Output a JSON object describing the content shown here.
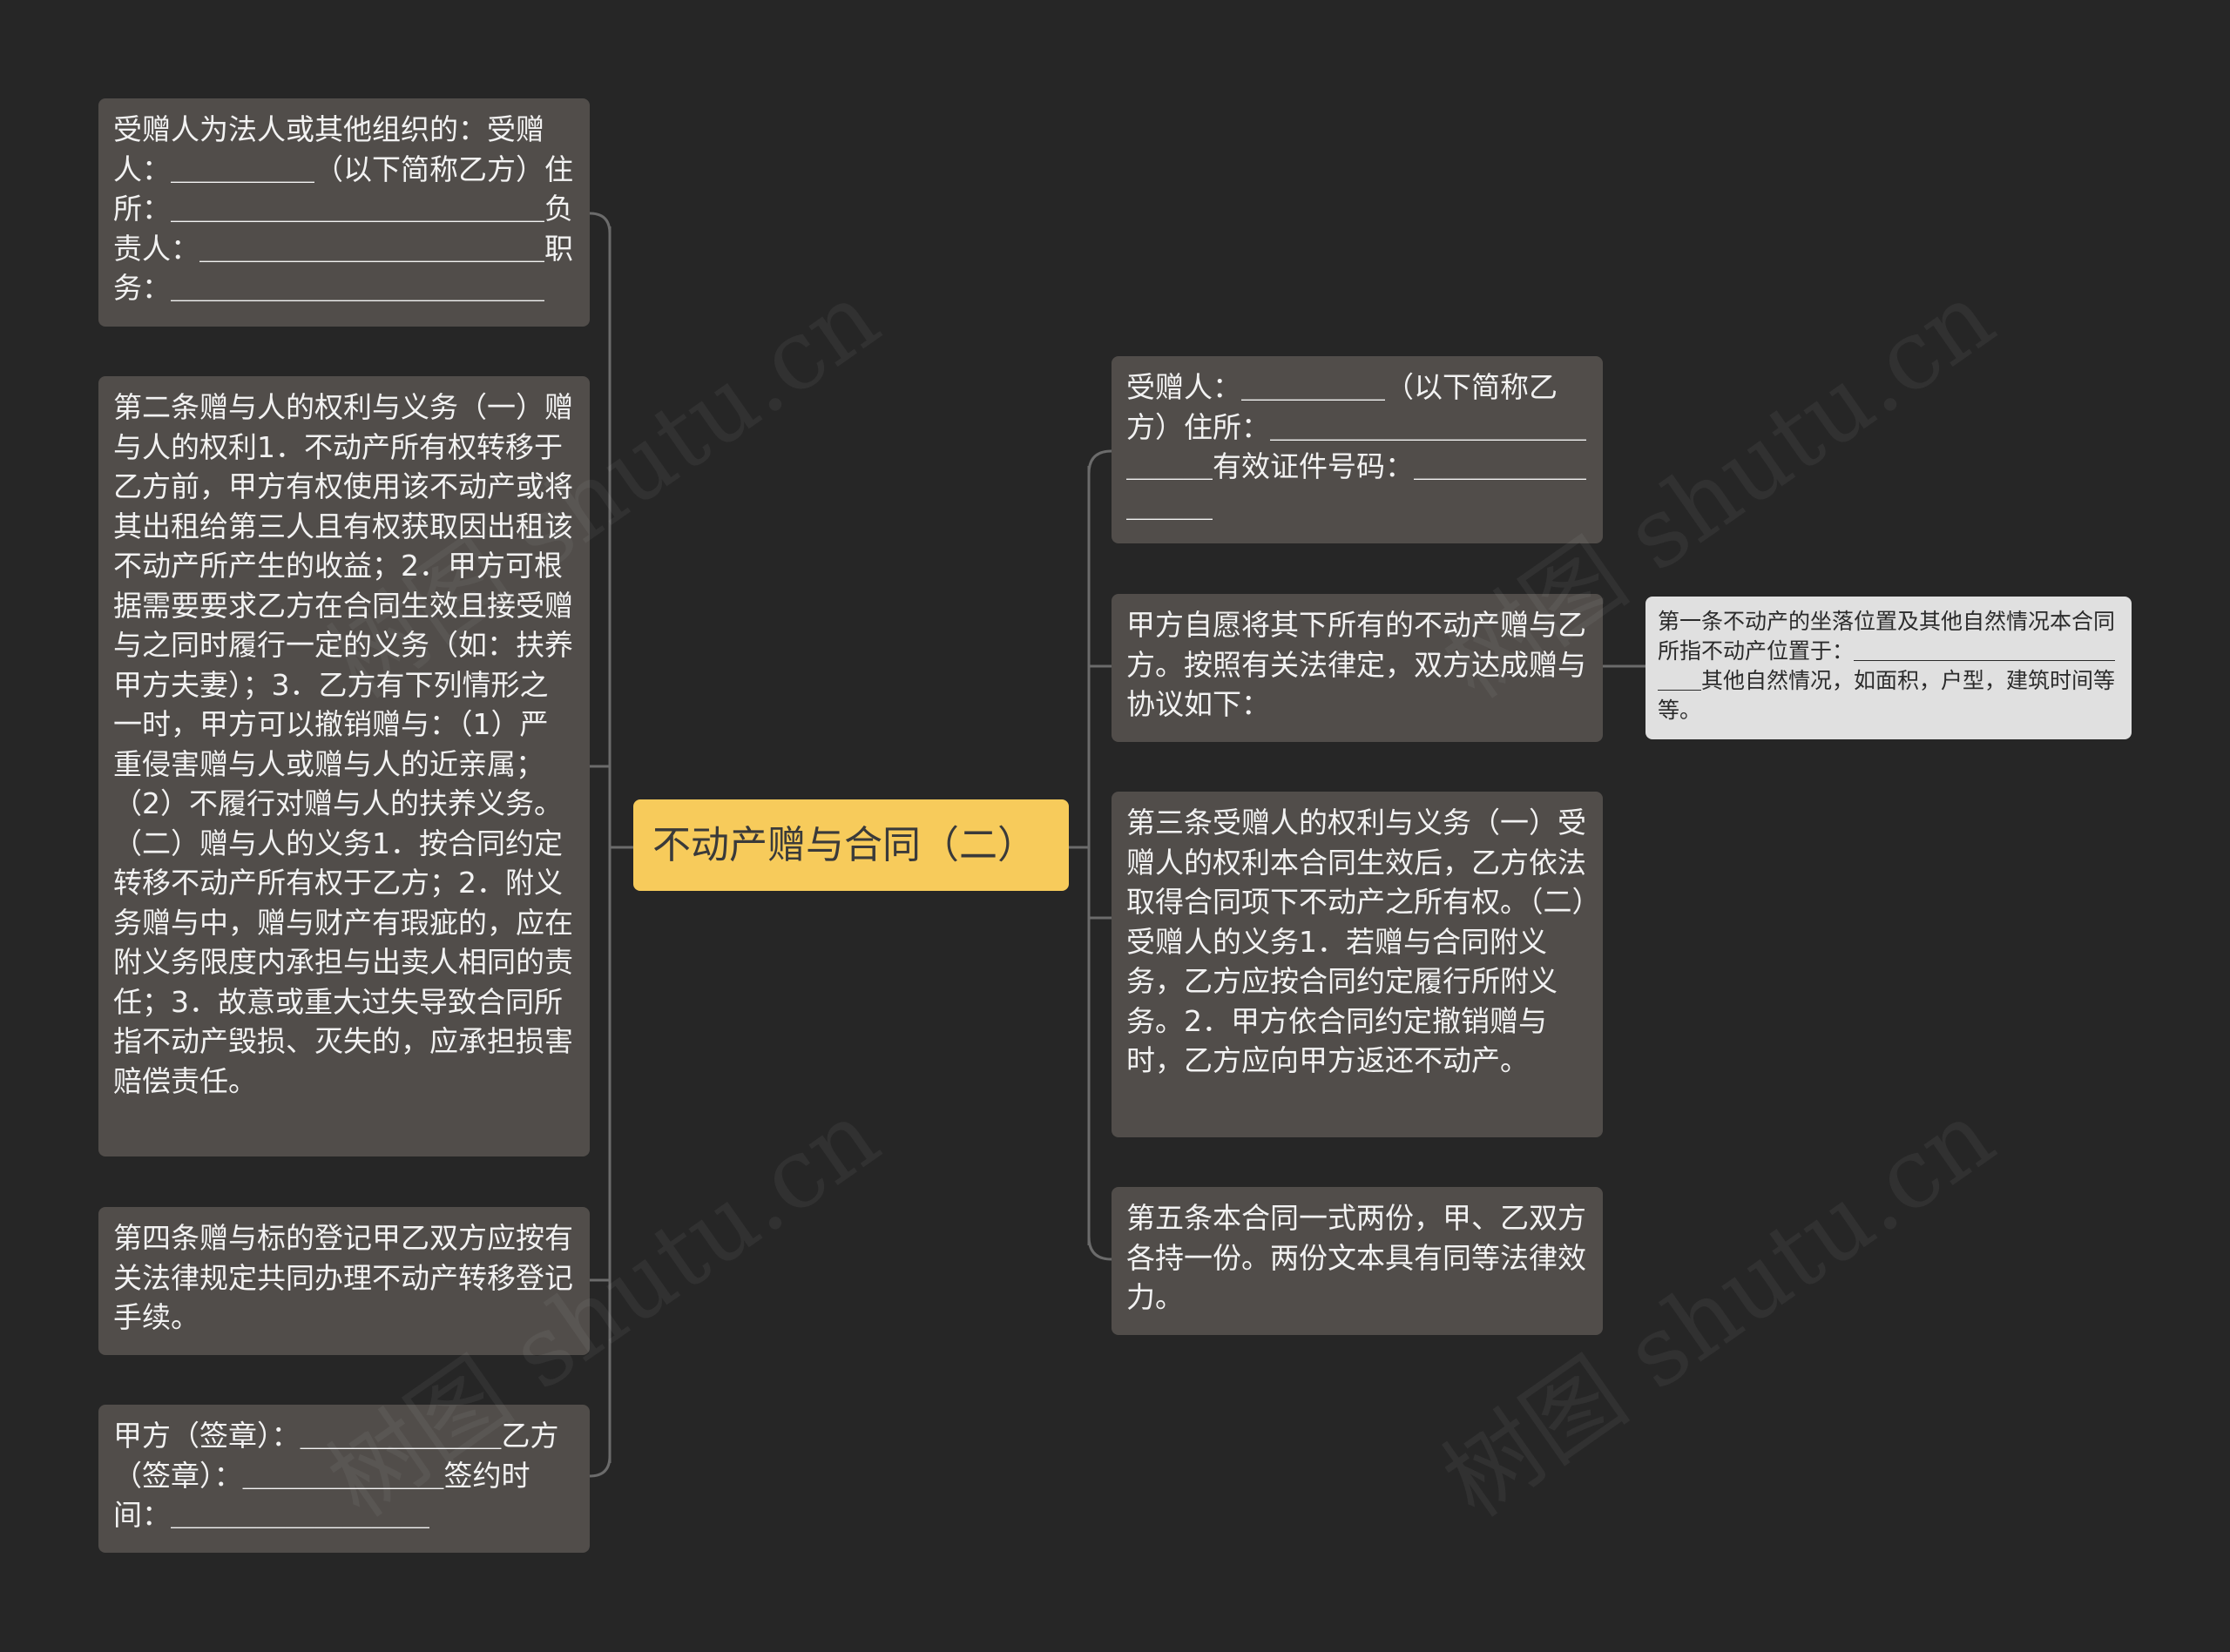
{
  "diagram": {
    "root": {
      "label": "不动产赠与合同（二）"
    },
    "left_nodes": [
      {
        "text": "受赠人为法人或其他组织的：受赠人：＿＿＿＿＿（以下简称乙方）住所：＿＿＿＿＿＿＿＿＿＿＿＿＿负责人：＿＿＿＿＿＿＿＿＿＿＿＿职务：＿＿＿＿＿＿＿＿＿＿＿＿＿"
      },
      {
        "text": "第二条赠与人的权利与义务（一）赠与人的权利1．不动产所有权转移于乙方前，甲方有权使用该不动产或将其出租给第三人且有权获取因出租该不动产所产生的收益；2．甲方可根据需要要求乙方在合同生效且接受赠与之同时履行一定的义务（如：扶养甲方夫妻）；3．乙方有下列情形之一时，甲方可以撤销赠与：（1）严重侵害赠与人或赠与人的近亲属；（2）不履行对赠与人的扶养义务。（二）赠与人的义务1．按合同约定转移不动产所有权于乙方；2．附义务赠与中，赠与财产有瑕疵的，应在附义务限度内承担与出卖人相同的责任；3．故意或重大过失导致合同所指不动产毁损、灭失的，应承担损害赔偿责任。"
      },
      {
        "text": "第四条赠与标的登记甲乙双方应按有关法律规定共同办理不动产转移登记手续。"
      },
      {
        "text": "甲方（签章）：＿＿＿＿＿＿＿乙方（签章）：＿＿＿＿＿＿＿签约时间：＿＿＿＿＿＿＿＿＿"
      }
    ],
    "right_nodes": [
      {
        "text": "受赠人：＿＿＿＿＿（以下简称乙方）住所：＿＿＿＿＿＿＿＿＿＿＿＿＿＿有效证件号码：＿＿＿＿＿＿＿＿＿"
      },
      {
        "text": "甲方自愿将其下所有的不动产赠与乙方。按照有关法律定，双方达成赠与协议如下："
      },
      {
        "text": "第三条受赠人的权利与义务（一）受赠人的权利本合同生效后，乙方依法取得合同项下不动产之所有权。（二）受赠人的义务1．若赠与合同附义务，乙方应按合同约定履行所附义务。2．甲方依合同约定撤销赠与时，乙方应向甲方返还不动产。"
      },
      {
        "text": "第五条本合同一式两份，甲、乙双方各持一份。两份文本具有同等法律效力。"
      }
    ],
    "sub_node": {
      "text": "第一条不动产的坐落位置及其他自然情况本合同所指不动产位置于：＿＿＿＿＿＿＿＿＿＿＿＿＿＿其他自然情况，如面积，户型，建筑时间等等。"
    }
  },
  "colors": {
    "background": "#262626",
    "node_dark": "#514d4a",
    "root": "#f7cb5b",
    "node_light": "#e0e0e0",
    "connector": "#6b6b6b"
  },
  "watermark": "树图 shutu.cn"
}
